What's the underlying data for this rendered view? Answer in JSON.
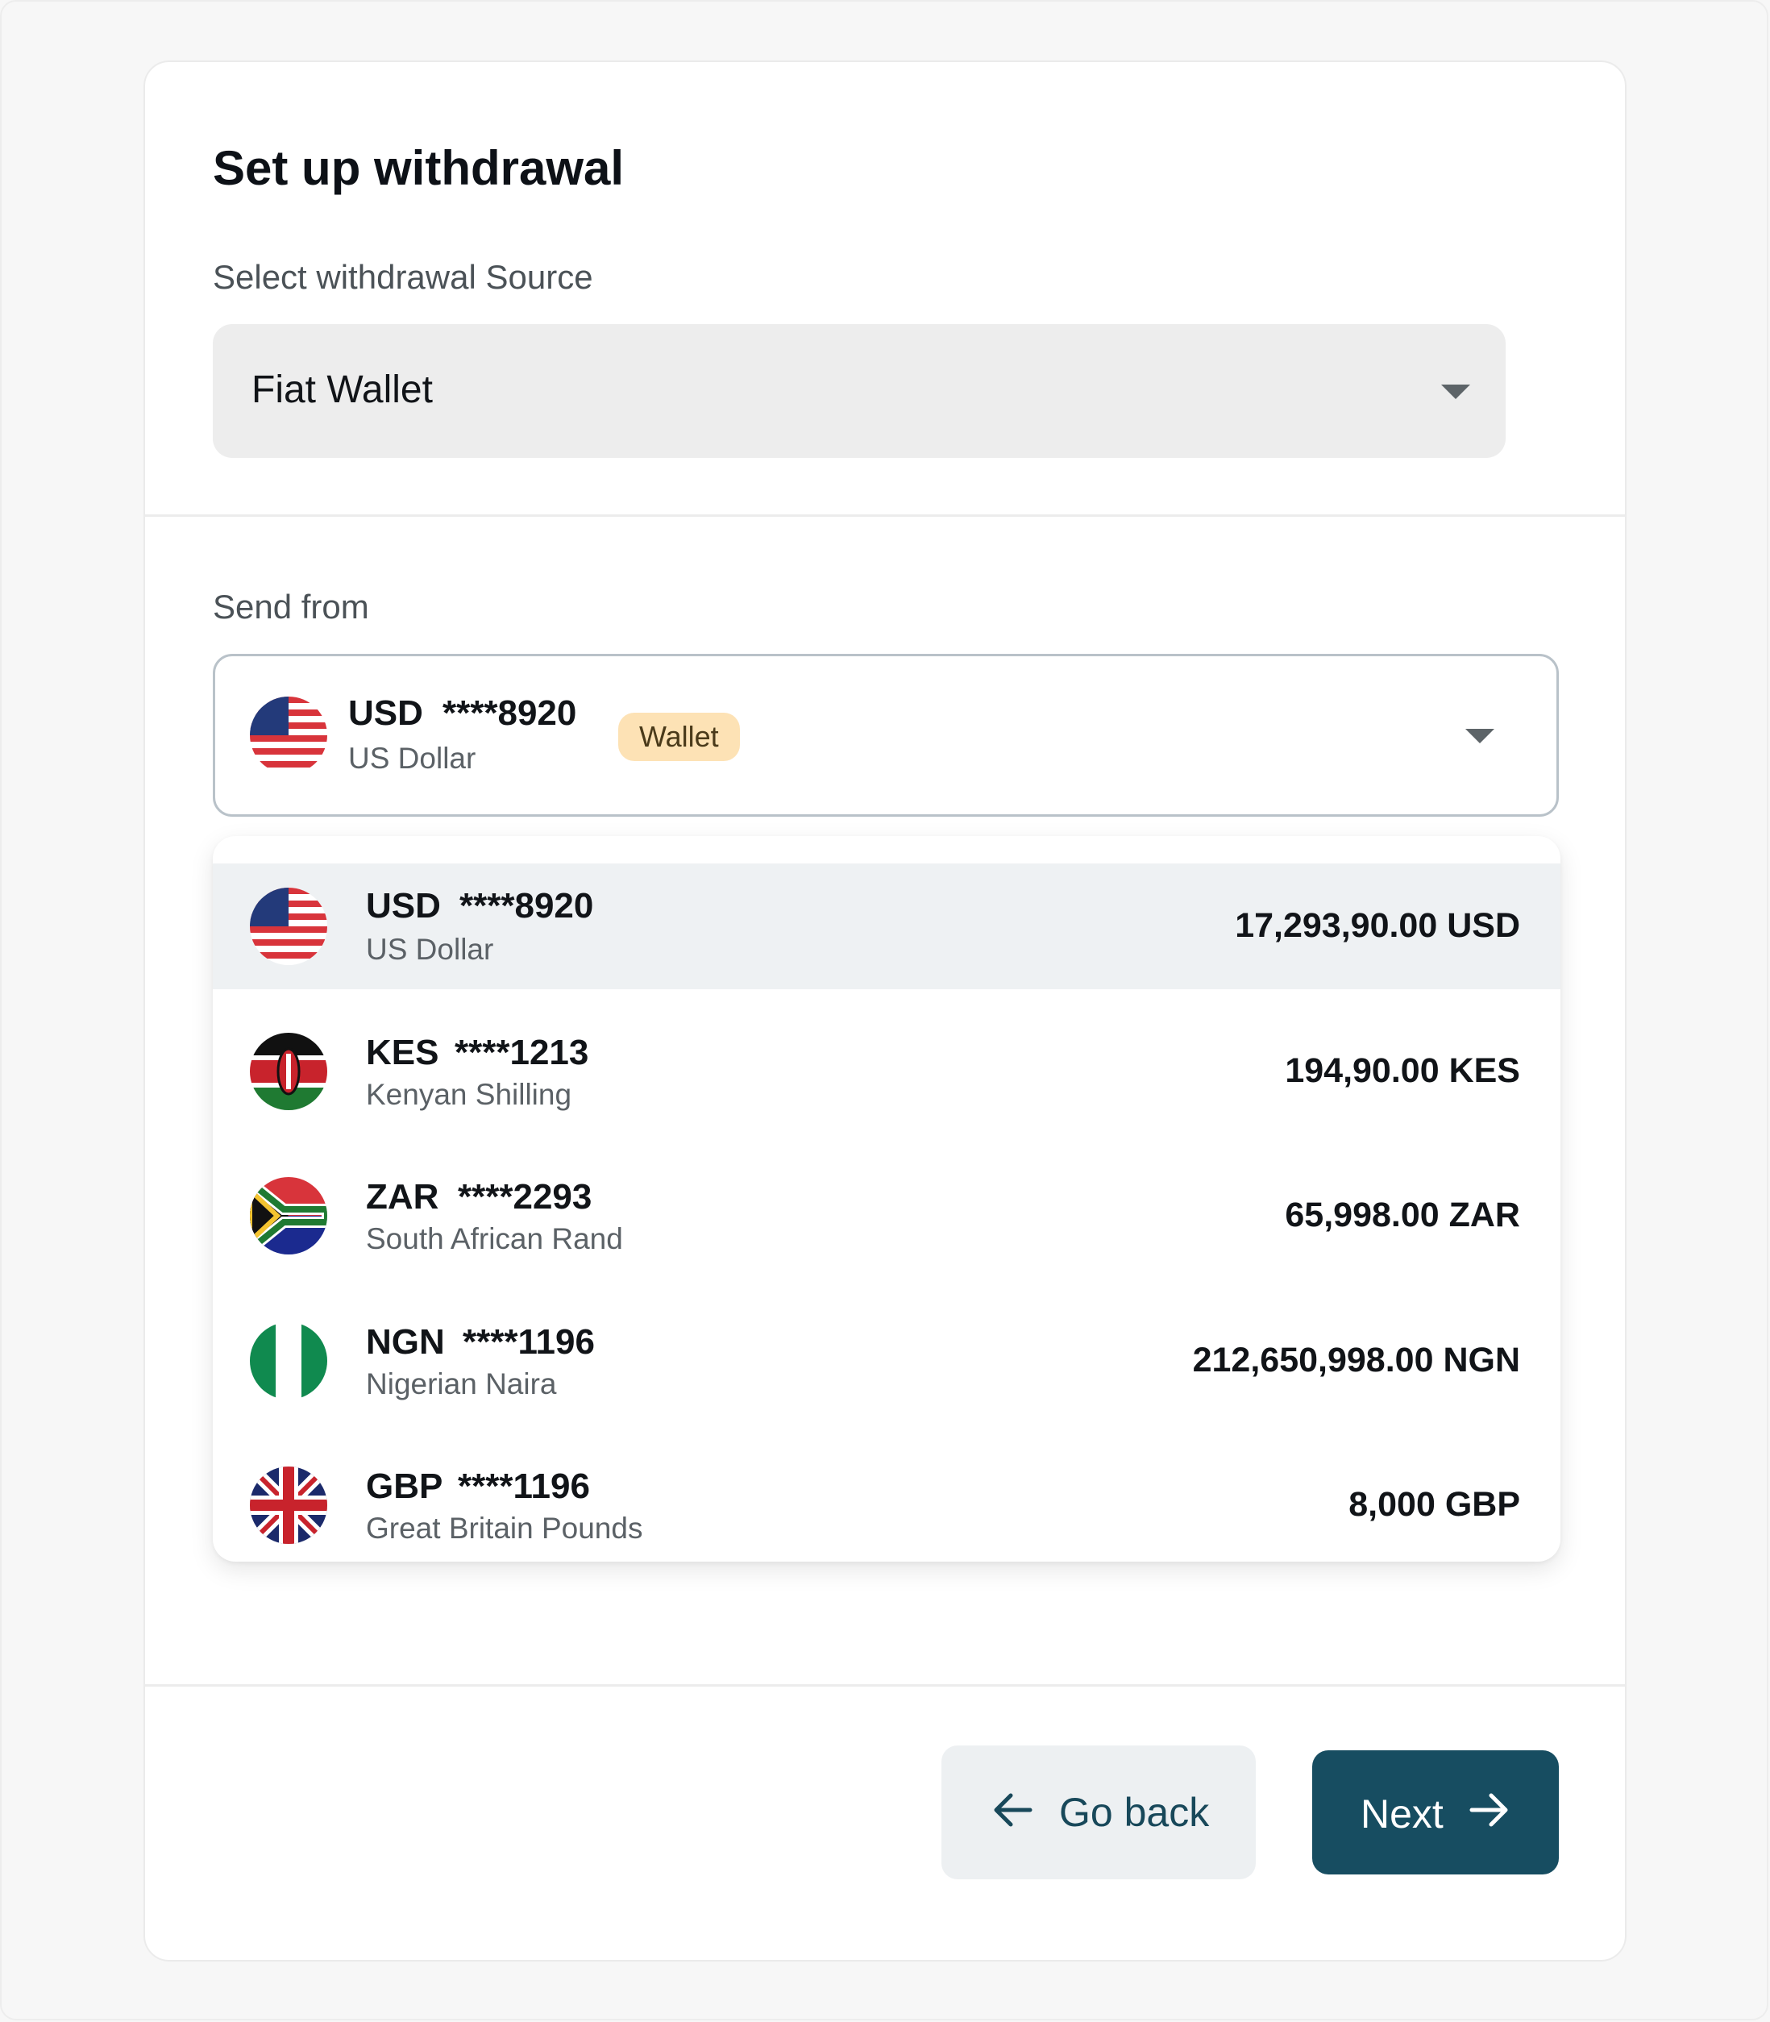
{
  "page_title": "Set up withdrawal",
  "source": {
    "label": "Select withdrawal Source",
    "value": "Fiat Wallet"
  },
  "send_from": {
    "label": "Send from",
    "selected": {
      "code": "USD",
      "masked": "****8920",
      "name": "US Dollar",
      "badge": "Wallet",
      "flag": "us-flag-icon"
    }
  },
  "accounts": [
    {
      "code": "USD",
      "masked": "****8920",
      "name": "US Dollar",
      "amount": "17,293,90.00 USD",
      "flag": "us-flag-icon",
      "selected": true
    },
    {
      "code": "KES",
      "masked": "****1213",
      "name": "Kenyan Shilling",
      "amount": "194,90.00 KES",
      "flag": "kenya-flag-icon",
      "selected": false
    },
    {
      "code": "ZAR",
      "masked": "****2293",
      "name": "South African Rand",
      "amount": "65,998.00 ZAR",
      "flag": "south-africa-flag-icon",
      "selected": false
    },
    {
      "code": "NGN",
      "masked": "****1196",
      "name": "Nigerian Naira",
      "amount": "212,650,998.00 NGN",
      "flag": "nigeria-flag-icon",
      "selected": false
    },
    {
      "code": "GBP",
      "masked": "****1196",
      "name": "Great Britain Pounds",
      "amount": "8,000 GBP",
      "flag": "uk-flag-icon",
      "selected": false
    }
  ],
  "actions": {
    "back_label": "Go back",
    "next_label": "Next",
    "back_icon": "arrow-left-icon",
    "next_icon": "arrow-right-icon"
  },
  "colors": {
    "primary": "#174d61",
    "badge_bg": "#fde2b5",
    "selected_row": "#eef1f3"
  }
}
